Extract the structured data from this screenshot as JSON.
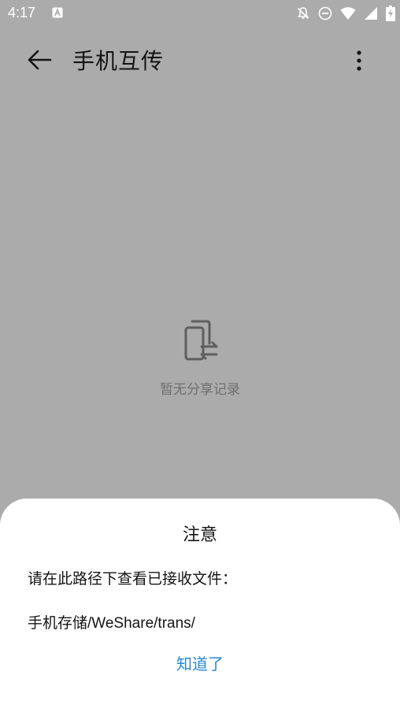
{
  "status_bar": {
    "time": "4:17",
    "icons": [
      "a-notification-icon",
      "bell-off-icon",
      "dnd-icon",
      "wifi-icon",
      "signal-icon",
      "battery-charging-icon"
    ]
  },
  "app_bar": {
    "title": "手机互传",
    "back_icon": "arrow-left-icon",
    "more_icon": "more-vertical-icon"
  },
  "empty_state": {
    "icon": "phone-transfer-icon",
    "text": "暂无分享记录"
  },
  "dialog": {
    "title": "注意",
    "message": "请在此路径下查看已接收文件：",
    "path": "手机存储/WeShare/trans/",
    "confirm_label": "知道了",
    "confirm_color": "#2a87d6"
  },
  "colors": {
    "scrim_background": "#ababab",
    "sheet_background": "#ffffff",
    "text_primary": "#141414",
    "text_secondary": "#6f6f6f"
  }
}
